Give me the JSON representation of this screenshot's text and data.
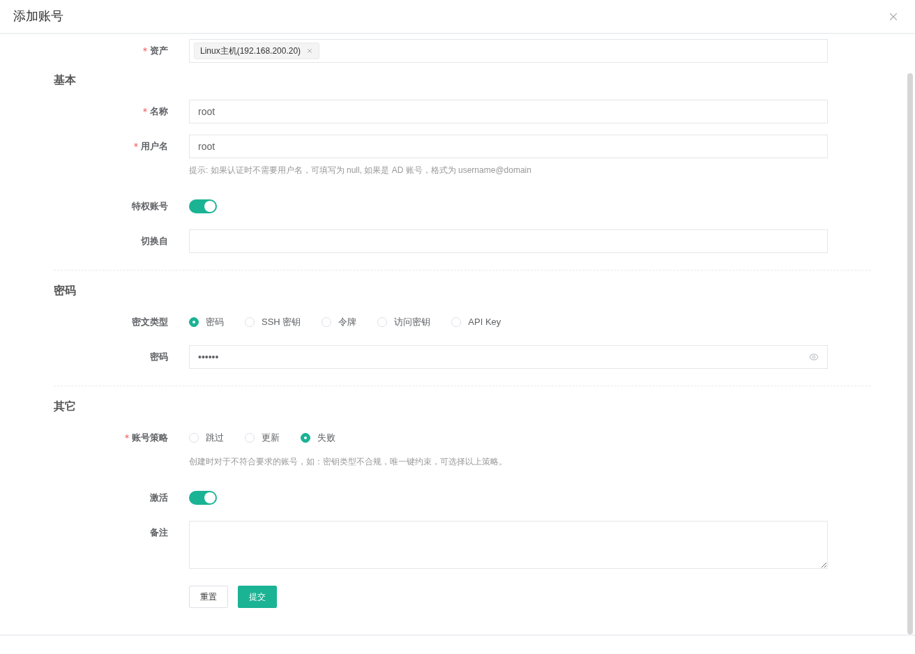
{
  "dialog": {
    "title": "添加账号"
  },
  "asset": {
    "label": "资产",
    "required": true,
    "tags": [
      "Linux主机(192.168.200.20)"
    ]
  },
  "sections": [
    {
      "title": "基本",
      "fields": [
        {
          "kind": "text",
          "label": "名称",
          "required": true,
          "value": "root"
        },
        {
          "kind": "text",
          "label": "用户名",
          "required": true,
          "value": "root",
          "hint": "提示: 如果认证时不需要用户名，可填写为 null, 如果是 AD 账号，格式为 username@domain"
        },
        {
          "kind": "switch",
          "label": "特权账号",
          "required": false,
          "on": true
        },
        {
          "kind": "text",
          "label": "切换自",
          "required": false
        }
      ]
    },
    {
      "title": "密码",
      "fields": [
        {
          "kind": "radio",
          "label": "密文类型",
          "required": false,
          "options": [
            {
              "label": "密码",
              "selected": true
            },
            {
              "label": "SSH 密钥",
              "selected": false
            },
            {
              "label": "令牌",
              "selected": false
            },
            {
              "label": "访问密钥",
              "selected": false
            },
            {
              "label": "API Key",
              "selected": false
            }
          ]
        },
        {
          "kind": "password",
          "label": "密码",
          "required": false,
          "value": "••••••"
        }
      ]
    },
    {
      "title": "其它",
      "fields": [
        {
          "kind": "radio",
          "label": "账号策略",
          "required": true,
          "options": [
            {
              "label": "跳过",
              "selected": false
            },
            {
              "label": "更新",
              "selected": false
            },
            {
              "label": "失败",
              "selected": true
            }
          ],
          "hint": "创建时对于不符合要求的账号，如：密钥类型不合规，唯一键约束，可选择以上策略。"
        },
        {
          "kind": "switch",
          "label": "激活",
          "required": false,
          "on": true
        },
        {
          "kind": "textarea",
          "label": "备注",
          "required": false
        }
      ]
    }
  ],
  "buttons": [
    {
      "label": "重置",
      "kind": "default"
    },
    {
      "label": "提交",
      "kind": "primary"
    }
  ]
}
